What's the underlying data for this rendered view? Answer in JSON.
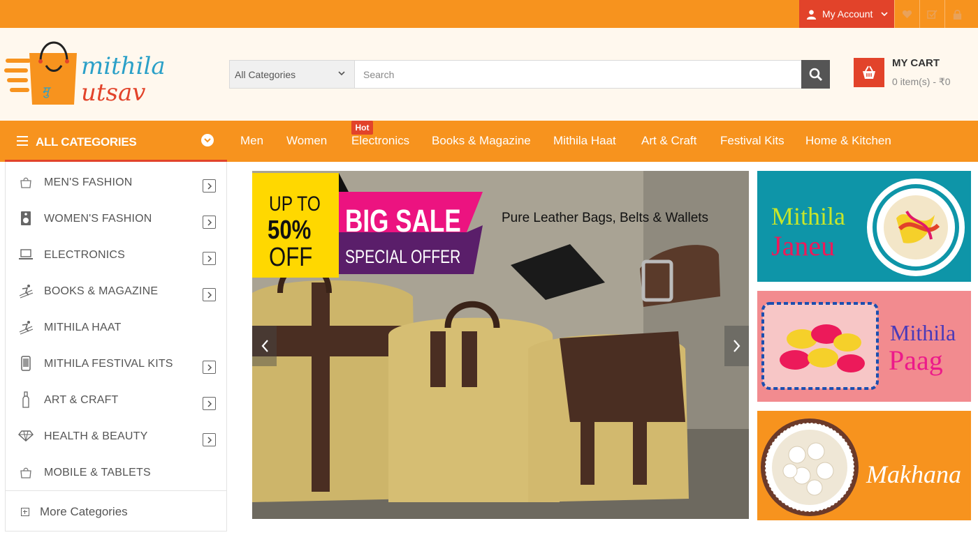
{
  "topbar": {
    "account_label": "My Account",
    "icons": [
      "user-icon",
      "heart-icon",
      "checklist-icon",
      "lock-icon"
    ]
  },
  "brand": {
    "logo_line1": "mithila",
    "logo_line2": "utsav",
    "logo_bag_text": "मु"
  },
  "search": {
    "category_selected": "All Categories",
    "placeholder": "Search"
  },
  "cart": {
    "title": "MY CART",
    "summary": "0 item(s) - ₹0"
  },
  "nav": {
    "all_categories": "ALL CATEGORIES",
    "hot_badge": "Hot",
    "items": [
      "Men",
      "Women",
      "Electronics",
      "Books & Magazine",
      "Mithila Haat",
      "Art & Craft",
      "Festival Kits",
      "Home & Kitchen"
    ]
  },
  "sidebar": {
    "items": [
      {
        "label": "MEN'S FASHION",
        "icon": "bag-icon",
        "has_submenu": true
      },
      {
        "label": "WOMEN'S FASHION",
        "icon": "speaker-icon",
        "has_submenu": true
      },
      {
        "label": "ELECTRONICS",
        "icon": "laptop-icon",
        "has_submenu": true
      },
      {
        "label": "BOOKS & MAGAZINE",
        "icon": "skier-icon",
        "has_submenu": true
      },
      {
        "label": "MITHILA HAAT",
        "icon": "skier-icon",
        "has_submenu": false
      },
      {
        "label": "MITHILA FESTIVAL KITS",
        "icon": "phone-icon",
        "has_submenu": true
      },
      {
        "label": "ART & CRAFT",
        "icon": "bottle-icon",
        "has_submenu": true
      },
      {
        "label": "HEALTH & BEAUTY",
        "icon": "diamond-icon",
        "has_submenu": true
      },
      {
        "label": "MOBILE & TABLETS",
        "icon": "bag-icon",
        "has_submenu": false
      }
    ],
    "more": "More Categories"
  },
  "hero": {
    "up_to": "UP TO",
    "percent": "50%",
    "off": "OFF",
    "big_sale": "BIG SALE",
    "special_offer": "SPECIAL OFFER",
    "tagline": "Pure Leather Bags, Belts & Wallets"
  },
  "banners": {
    "b1_line1": "Mithila",
    "b1_line2": "Janeu",
    "b2_line1": "Mithila",
    "b2_line2": "Paag",
    "b3_text": "Makhana"
  },
  "colors": {
    "orange": "#f7931e",
    "red": "#e2432a",
    "cream": "#fff8ee"
  }
}
